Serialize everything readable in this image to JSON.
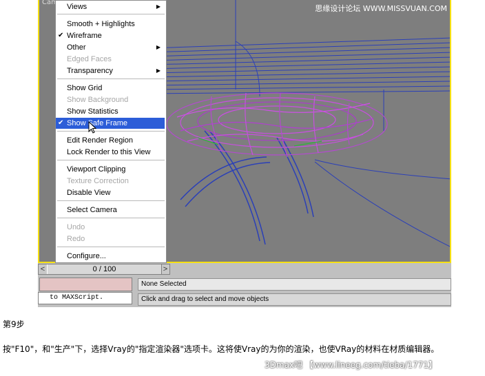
{
  "viewport": {
    "camera_label": "Cam",
    "watermark": "思缘设计论坛 WWW.MISSVUAN.COM"
  },
  "menu": {
    "items": [
      {
        "label": "Views",
        "state": "normal",
        "submenu": true
      },
      {
        "label": "Smooth + Highlights",
        "state": "normal"
      },
      {
        "label": "Wireframe",
        "state": "checked"
      },
      {
        "label": "Other",
        "state": "normal",
        "submenu": true
      },
      {
        "label": "Edged Faces",
        "state": "disabled"
      },
      {
        "label": "Transparency",
        "state": "normal",
        "submenu": true
      },
      {
        "label": "Show Grid",
        "state": "normal"
      },
      {
        "label": "Show Background",
        "state": "disabled"
      },
      {
        "label": "Show Statistics",
        "state": "normal"
      },
      {
        "label": "Show Safe Frame",
        "state": "selected-checked"
      },
      {
        "label": "Edit Render Region",
        "state": "normal"
      },
      {
        "label": "Lock Render to this View",
        "state": "normal"
      },
      {
        "label": "Viewport Clipping",
        "state": "normal"
      },
      {
        "label": "Texture Correction",
        "state": "disabled"
      },
      {
        "label": "Disable View",
        "state": "normal"
      },
      {
        "label": "Select Camera",
        "state": "normal"
      },
      {
        "label": "Undo",
        "state": "disabled"
      },
      {
        "label": "Redo",
        "state": "disabled"
      },
      {
        "label": "Configure...",
        "state": "normal"
      }
    ]
  },
  "statusbar": {
    "slider_left": "<",
    "slider_label": "0 / 100",
    "slider_right": ">",
    "script_text": "to MAXScript.",
    "prompt_status": "None Selected",
    "prompt_hint": "Click and drag to select and move objects"
  },
  "article": {
    "step_title": "第9步",
    "paragraph": "按\"F10\"，和\"生产\"下，选择Vray的\"指定渲染器\"选项卡。这将使Vray的为你的渲染，也使VRay的材料在材质编辑器。",
    "watermark": "3Dmax吧 【www.lineeg.com/tieba/1771】"
  }
}
